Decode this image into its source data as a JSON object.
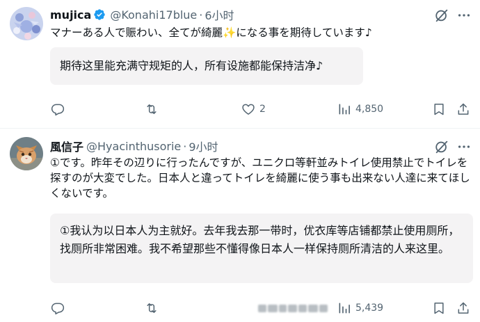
{
  "tweets": [
    {
      "name": "mujica",
      "handle": "@Konahi17blue",
      "separator": "·",
      "time": "6小时",
      "verified": true,
      "text": "マナーある人で賑わい、全てが綺麗✨になる事を期待しています♪",
      "translation": "期待这里能充满守规矩的人，所有设施都能保持洁净♪",
      "actions": {
        "reply": "",
        "retweet": "",
        "like": "2",
        "views": "4,850"
      }
    },
    {
      "name": "風信子",
      "handle": "@Hyacinthusorie",
      "separator": "·",
      "time": "9小时",
      "verified": false,
      "text": "①です。昨年その辺りに行ったんですが、ユニクロ等軒並みトイレ使用禁止でトイレを探すのが大変でした。日本人と違ってトイレを綺麗に使う事も出来ない人達に来てほしくないです。",
      "translation": "①我认为以日本人为主就好。去年我去那一带时，优衣库等店铺都禁止使用厕所，找厕所非常困难。我不希望那些不懂得像日本人一样保持厕所清洁的人来这里。",
      "actions": {
        "reply": "",
        "retweet": "",
        "like": "",
        "views": "5,439"
      }
    }
  ],
  "colors": {
    "text": "#0f1419",
    "secondary": "#536471",
    "verified": "#1d9bf0",
    "translation_bg": "#f4f3f4",
    "divider": "#eff3f4"
  },
  "icons": [
    "verified-badge-icon",
    "grok-icon",
    "more-icon",
    "reply-icon",
    "retweet-icon",
    "like-icon",
    "views-icon",
    "bookmark-icon",
    "share-icon"
  ]
}
